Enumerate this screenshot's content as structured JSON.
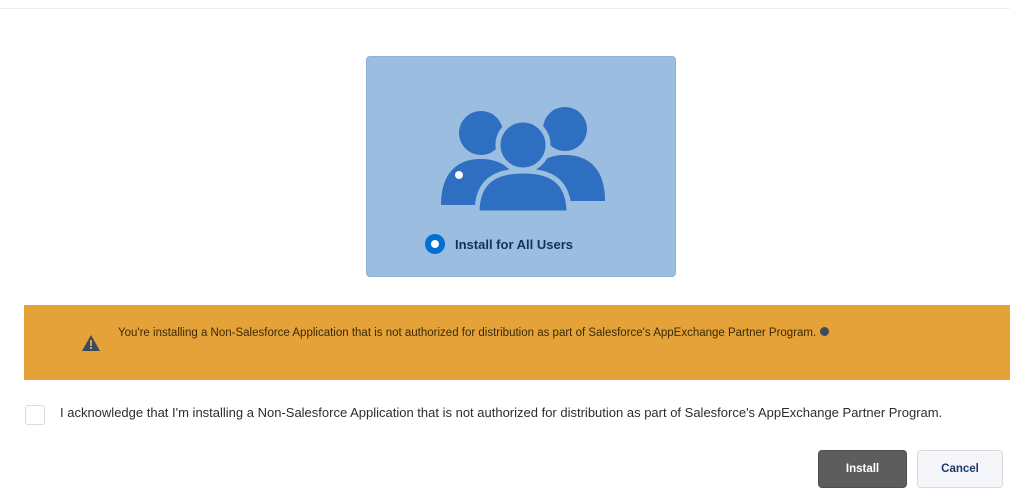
{
  "install_option": {
    "label": "Install for All Users",
    "selected": true,
    "icon": "users-group-icon",
    "card_color": "#9bbde0"
  },
  "warning": {
    "icon": "warning-icon",
    "text": "You're installing a Non-Salesforce Application that is not authorized for distribution as part of Salesforce's AppExchange Partner Program.",
    "background": "#e4a239"
  },
  "acknowledgement": {
    "checked": false,
    "text": "I acknowledge that I'm installing a Non-Salesforce Application that is not authorized for distribution as part of Salesforce's AppExchange Partner Program."
  },
  "actions": {
    "install_label": "Install",
    "cancel_label": "Cancel"
  }
}
